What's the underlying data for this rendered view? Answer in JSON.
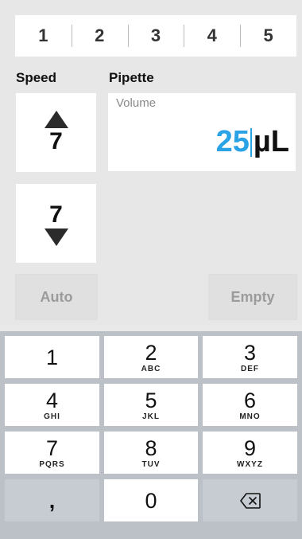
{
  "tabs": [
    "1",
    "2",
    "3",
    "4",
    "5"
  ],
  "speed": {
    "label": "Speed",
    "up_value": "7",
    "down_value": "7"
  },
  "pipette": {
    "label": "Pipette",
    "volume_label": "Volume",
    "volume_value": "25",
    "volume_unit": "µL"
  },
  "buttons": {
    "auto": "Auto",
    "empty": "Empty"
  },
  "keyboard": {
    "keys": [
      {
        "num": "1",
        "letters": ""
      },
      {
        "num": "2",
        "letters": "ABC"
      },
      {
        "num": "3",
        "letters": "DEF"
      },
      {
        "num": "4",
        "letters": "GHI"
      },
      {
        "num": "5",
        "letters": "JKL"
      },
      {
        "num": "6",
        "letters": "MNO"
      },
      {
        "num": "7",
        "letters": "PQRS"
      },
      {
        "num": "8",
        "letters": "TUV"
      },
      {
        "num": "9",
        "letters": "WXYZ"
      }
    ],
    "decimal": ",",
    "zero": "0"
  },
  "icons": {
    "up": "up-arrow-icon",
    "down": "down-arrow-icon",
    "backspace": "backspace-icon"
  },
  "colors": {
    "accent": "#2aa3e6"
  }
}
